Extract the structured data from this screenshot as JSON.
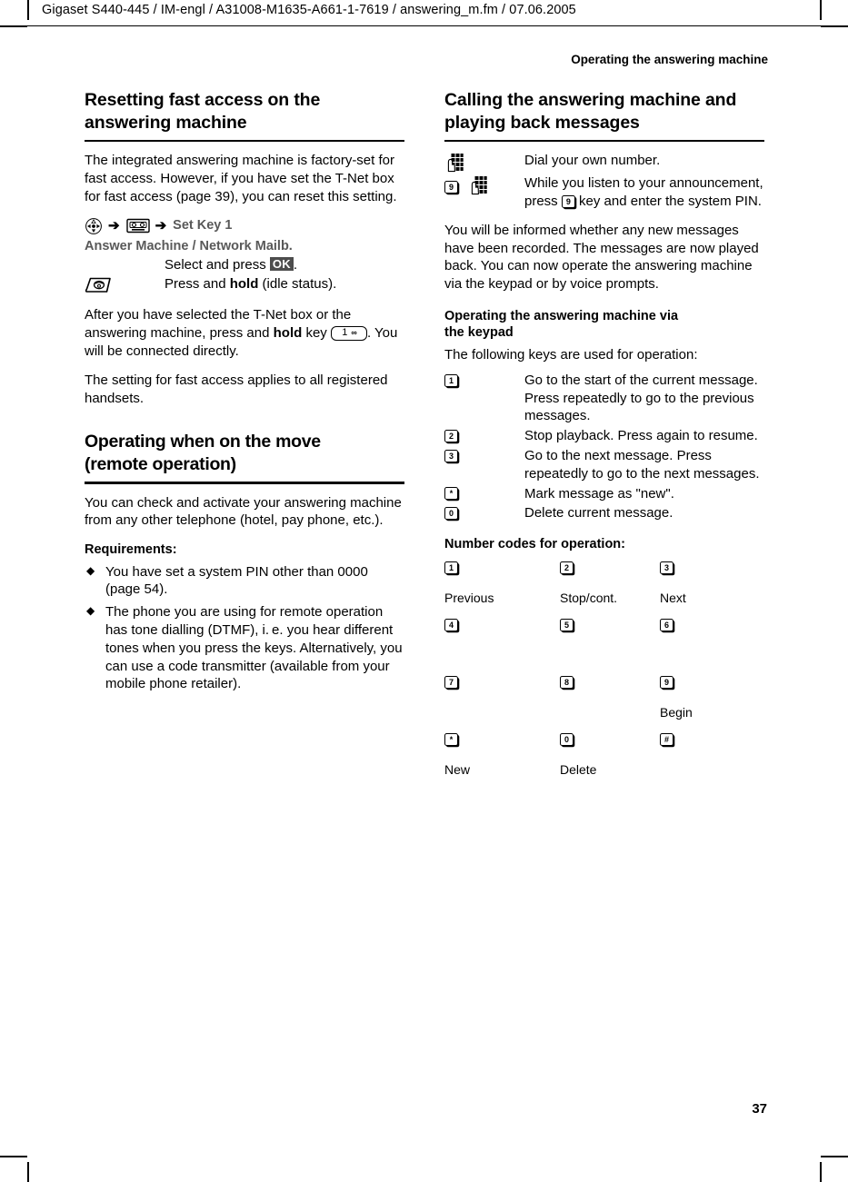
{
  "header": {
    "running_head": "Gigaset S440-445 / IM-engl / A31008-M1635-A661-1-7619 / answering_m.fm / 07.06.2005",
    "chapter": "Operating the answering machine"
  },
  "page_number": "37",
  "left_column": {
    "section1": {
      "title_line1": "Resetting fast access on the",
      "title_line2": "answering machine",
      "intro": "The integrated answering machine is factory-set for fast access. However, if you have set the T-Net box for fast access (page 39), you can reset this setting.",
      "path": {
        "nav_icon": "navigation-key-icon",
        "arrow1": "➔",
        "answering_machine_icon": "answering-machine-cassette-icon",
        "arrow2": "➔",
        "menu_item": "Set Key 1"
      },
      "menu_line": "Answer Machine / Network Mailb.",
      "steps": [
        {
          "icon": "",
          "text_before": "Select and press ",
          "key": "OK",
          "text_after": "."
        },
        {
          "icon": "end-call-key-icon",
          "text_before": "Press and ",
          "bold": "hold",
          "text_after": " (idle status)."
        }
      ],
      "para2_a": "After you have selected the T-Net box or the answering machine, press and ",
      "para2_bold": "hold",
      "para2_b": " key ",
      "para2_key_num": "1",
      "para2_key_sym": "∞",
      "para2_c": ". You will be connected directly.",
      "para3": "The setting for fast access applies to all registered handsets."
    },
    "section2": {
      "title_line1": "Operating when on the move",
      "title_line2": "(remote operation)",
      "intro": "You can check and activate your answering machine from any other telephone (hotel, pay phone, etc.).",
      "requirements_title": "Requirements:",
      "requirements": [
        "You have set a system PIN other than 0000 (page 54).",
        "The phone you are using for remote operation has tone dialling (DTMF), i. e. you hear different tones when you press the keys. Alternatively, you can use a code transmitter (available from your mobile phone retailer)."
      ]
    }
  },
  "right_column": {
    "section1": {
      "title_line1": "Calling the answering machine and",
      "title_line2": "playing back messages",
      "steps": [
        {
          "icons": [
            "keypad-hand-icon"
          ],
          "text": "Dial your own number."
        },
        {
          "icons": [
            "key-9-icon",
            "keypad-hand-icon"
          ],
          "text_part1": "While you listen to your announcement, press ",
          "inline_key": "9",
          "text_part2": " key and enter the system PIN."
        }
      ],
      "para": "You will be informed whether any new messages have been recorded. The messages are now played back. You can now operate the answering machine via the keypad or by voice prompts."
    },
    "section2": {
      "subtitle_line1": "Operating the answering machine via",
      "subtitle_line2": "the keypad",
      "intro": "The following keys are used for operation:",
      "keys": [
        {
          "key": "1",
          "desc": "Go to the start of the current message. Press repeatedly to go to the previous messages."
        },
        {
          "key": "2",
          "desc": "Stop playback. Press again to resume."
        },
        {
          "key": "3",
          "desc": "Go to the next message. Press repeatedly to go to the next messages."
        },
        {
          "key": "*",
          "desc": "Mark message as \"new\"."
        },
        {
          "key": "0",
          "desc": "Delete current message."
        }
      ]
    },
    "section3": {
      "title": "Number codes for operation:",
      "grid": [
        {
          "key": "1",
          "label": "Previous"
        },
        {
          "key": "2",
          "label": "Stop/cont."
        },
        {
          "key": "3",
          "label": "Next"
        },
        {
          "key": "4",
          "label": ""
        },
        {
          "key": "5",
          "label": ""
        },
        {
          "key": "6",
          "label": ""
        },
        {
          "key": "7",
          "label": ""
        },
        {
          "key": "8",
          "label": ""
        },
        {
          "key": "9",
          "label": "Begin"
        },
        {
          "key": "*",
          "label": "New"
        },
        {
          "key": "0",
          "label": "Delete"
        },
        {
          "key": "#",
          "label": ""
        }
      ]
    }
  },
  "colors": {
    "text": "#000000",
    "menu_gray": "#595959",
    "softkey_bg": "#4d4d4d"
  }
}
